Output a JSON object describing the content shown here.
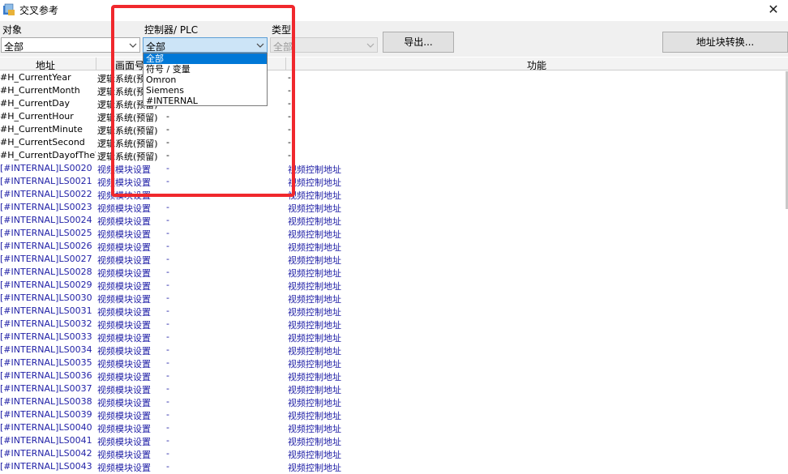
{
  "window": {
    "title": "交叉参考",
    "close_glyph": "✕"
  },
  "filters": {
    "object": {
      "label": "对象",
      "value": "全部"
    },
    "controller": {
      "label": "控制器/  PLC",
      "value": "全部"
    },
    "type": {
      "label": "类型",
      "value": "全部"
    }
  },
  "buttons": {
    "export": "导出...",
    "convert": "地址块转换..."
  },
  "dropdown": {
    "options": [
      "全部",
      "符号 / 变量",
      "Omron",
      "Siemens",
      "#INTERNAL"
    ],
    "selected_index": 0
  },
  "table": {
    "headers": {
      "address": "地址",
      "screen": "画面号",
      "function": "功能"
    },
    "rows": [
      {
        "address": "#H_CurrentYear",
        "screen": "逻辑系统(预留)",
        "controller": "",
        "function": "-"
      },
      {
        "address": "#H_CurrentMonth",
        "screen": "逻辑系统(预留)",
        "controller": "",
        "function": "-"
      },
      {
        "address": "#H_CurrentDay",
        "screen": "逻辑系统(预留)",
        "controller": "",
        "function": "-"
      },
      {
        "address": "#H_CurrentHour",
        "screen": "逻辑系统(预留)",
        "controller": "-",
        "function": "-"
      },
      {
        "address": "#H_CurrentMinute",
        "screen": "逻辑系统(预留)",
        "controller": "-",
        "function": "-"
      },
      {
        "address": "#H_CurrentSecond",
        "screen": "逻辑系统(预留)",
        "controller": "-",
        "function": "-"
      },
      {
        "address": "#H_CurrentDayofTheW",
        "screen": "逻辑系统(预留)",
        "controller": "-",
        "function": "-"
      },
      {
        "address": "[#INTERNAL]LS0020",
        "screen": "视频模块设置",
        "controller": "-",
        "function": "视频控制地址"
      },
      {
        "address": "[#INTERNAL]LS0021",
        "screen": "视频模块设置",
        "controller": "-",
        "function": "视频控制地址"
      },
      {
        "address": "[#INTERNAL]LS0022",
        "screen": "视频模块设置",
        "controller": "",
        "function": "视频控制地址"
      },
      {
        "address": "[#INTERNAL]LS0023",
        "screen": "视频模块设置",
        "controller": "-",
        "function": "视频控制地址"
      },
      {
        "address": "[#INTERNAL]LS0024",
        "screen": "视频模块设置",
        "controller": "-",
        "function": "视频控制地址"
      },
      {
        "address": "[#INTERNAL]LS0025",
        "screen": "视频模块设置",
        "controller": "-",
        "function": "视频控制地址"
      },
      {
        "address": "[#INTERNAL]LS0026",
        "screen": "视频模块设置",
        "controller": "-",
        "function": "视频控制地址"
      },
      {
        "address": "[#INTERNAL]LS0027",
        "screen": "视频模块设置",
        "controller": "-",
        "function": "视频控制地址"
      },
      {
        "address": "[#INTERNAL]LS0028",
        "screen": "视频模块设置",
        "controller": "-",
        "function": "视频控制地址"
      },
      {
        "address": "[#INTERNAL]LS0029",
        "screen": "视频模块设置",
        "controller": "-",
        "function": "视频控制地址"
      },
      {
        "address": "[#INTERNAL]LS0030",
        "screen": "视频模块设置",
        "controller": "-",
        "function": "视频控制地址"
      },
      {
        "address": "[#INTERNAL]LS0031",
        "screen": "视频模块设置",
        "controller": "-",
        "function": "视频控制地址"
      },
      {
        "address": "[#INTERNAL]LS0032",
        "screen": "视频模块设置",
        "controller": "-",
        "function": "视频控制地址"
      },
      {
        "address": "[#INTERNAL]LS0033",
        "screen": "视频模块设置",
        "controller": "-",
        "function": "视频控制地址"
      },
      {
        "address": "[#INTERNAL]LS0034",
        "screen": "视频模块设置",
        "controller": "-",
        "function": "视频控制地址"
      },
      {
        "address": "[#INTERNAL]LS0035",
        "screen": "视频模块设置",
        "controller": "-",
        "function": "视频控制地址"
      },
      {
        "address": "[#INTERNAL]LS0036",
        "screen": "视频模块设置",
        "controller": "-",
        "function": "视频控制地址"
      },
      {
        "address": "[#INTERNAL]LS0037",
        "screen": "视频模块设置",
        "controller": "-",
        "function": "视频控制地址"
      },
      {
        "address": "[#INTERNAL]LS0038",
        "screen": "视频模块设置",
        "controller": "-",
        "function": "视频控制地址"
      },
      {
        "address": "[#INTERNAL]LS0039",
        "screen": "视频模块设置",
        "controller": "-",
        "function": "视频控制地址"
      },
      {
        "address": "[#INTERNAL]LS0040",
        "screen": "视频模块设置",
        "controller": "-",
        "function": "视频控制地址"
      },
      {
        "address": "[#INTERNAL]LS0041",
        "screen": "视频模块设置",
        "controller": "-",
        "function": "视频控制地址"
      },
      {
        "address": "[#INTERNAL]LS0042",
        "screen": "视频模块设置",
        "controller": "-",
        "function": "视频控制地址"
      },
      {
        "address": "[#INTERNAL]LS0043",
        "screen": "视频模块设置",
        "controller": "-",
        "function": "视频控制地址"
      }
    ]
  },
  "colors": {
    "internal_text": "#1f1fa6",
    "highlight": "#f0282d",
    "selection": "#0078d7"
  }
}
